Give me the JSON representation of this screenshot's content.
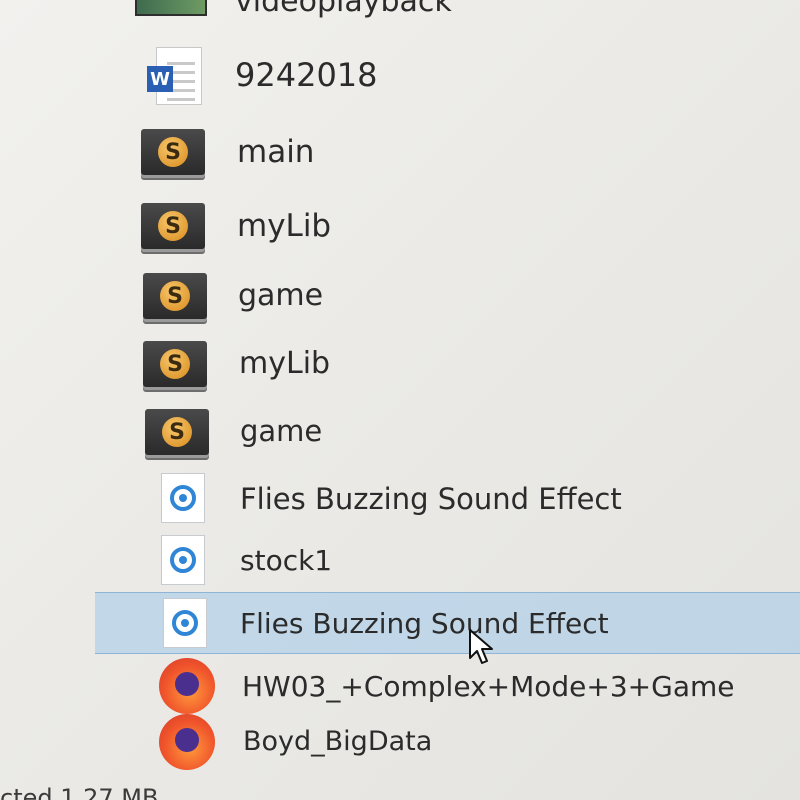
{
  "files": [
    {
      "name": "videoplayback",
      "icon": "video-icon"
    },
    {
      "name": "9242018",
      "icon": "word-document-icon"
    },
    {
      "name": "main",
      "icon": "sublime-text-file-icon"
    },
    {
      "name": "myLib",
      "icon": "sublime-text-file-icon"
    },
    {
      "name": "game",
      "icon": "sublime-text-file-icon"
    },
    {
      "name": "myLib",
      "icon": "sublime-text-file-icon"
    },
    {
      "name": "game",
      "icon": "sublime-text-file-icon"
    },
    {
      "name": "Flies Buzzing Sound Effect",
      "icon": "audio-file-icon"
    },
    {
      "name": "stock1",
      "icon": "audio-file-icon"
    },
    {
      "name": "Flies Buzzing Sound Effect",
      "icon": "audio-file-icon",
      "selected": true
    },
    {
      "name": "HW03_+Complex+Mode+3+Game",
      "icon": "firefox-icon"
    },
    {
      "name": "Boyd_BigData",
      "icon": "firefox-icon"
    }
  ],
  "icon_glyphs": {
    "word_badge": "W",
    "sublime_badge": "S"
  },
  "status_bar": {
    "text": "cted  1.27 MB"
  },
  "colors": {
    "selection": "#a0c8eb",
    "audio_ring": "#2f86d6",
    "word_blue": "#2b5fb4"
  }
}
